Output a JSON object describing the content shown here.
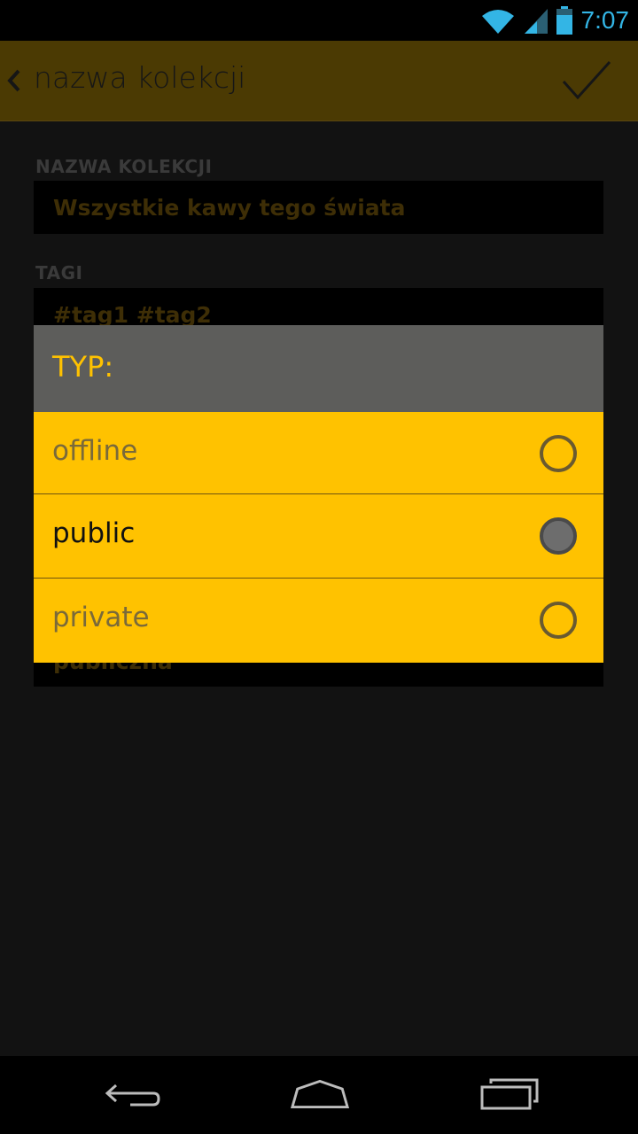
{
  "status_bar": {
    "time": "7:07",
    "icons": [
      "wifi-icon",
      "signal-icon",
      "battery-icon"
    ],
    "accent_color": "#33b5e5"
  },
  "action_bar": {
    "title": "nazwa kolekcji",
    "back_icon": "chevron-left-icon",
    "confirm_icon": "checkmark-icon",
    "background_color": "#4b3a03"
  },
  "form": {
    "name_label": "NAZWA KOLEKCJI",
    "name_value": "Wszystkie kawy tego świata",
    "tags_label": "TAGI",
    "tags_value": "#tag1 #tag2",
    "type_value": "publiczna"
  },
  "dialog": {
    "title": "TYP:",
    "options": [
      {
        "label": "offline",
        "selected": false
      },
      {
        "label": "public",
        "selected": true
      },
      {
        "label": "private",
        "selected": false
      }
    ],
    "background_color": "#ffc200",
    "header_color": "#5d5d5b"
  },
  "nav_bar": {
    "buttons": [
      "back-icon",
      "home-icon",
      "recent-apps-icon"
    ]
  }
}
